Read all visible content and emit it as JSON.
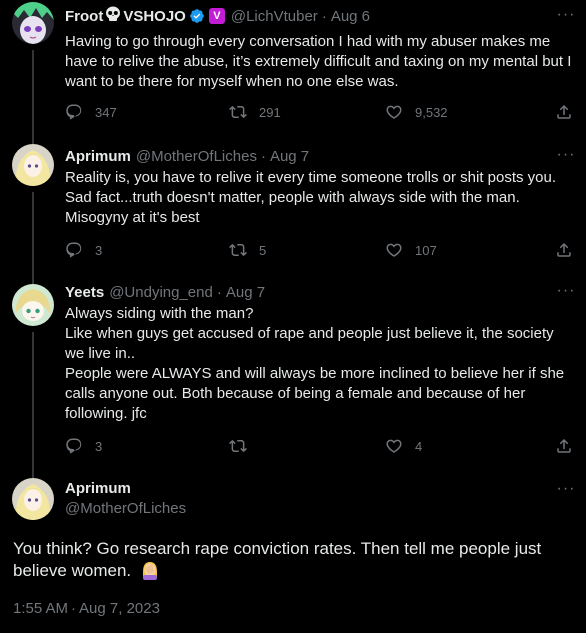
{
  "tweets": [
    {
      "name": "Froot",
      "name_suffix": "VSHOJO",
      "org_badge": "V",
      "handle": "@LichVtuber",
      "date": "Aug 6",
      "text": "Having to go through every conversation I had with my abuser makes me have to relive the abuse, it’s extremely difficult and taxing on my mental but I want to be there for myself when no one else was.",
      "replies": "347",
      "retweets": "291",
      "likes": "9,532"
    },
    {
      "name": "Aprimum",
      "handle": "@MotherOfLiches",
      "date": "Aug 7",
      "text": "Reality is, you have to relive it every time someone trolls or shit posts you. Sad fact...truth doesn't matter, people with always side with the man. Misogyny at it's best",
      "replies": "3",
      "retweets": "5",
      "likes": "107"
    },
    {
      "name": "Yeets",
      "handle": "@Undying_end",
      "date": "Aug 7",
      "text": "Always siding with the man?\nLike when guys get accused of rape and people just believe it, the society we live in..\nPeople were ALWAYS and will always be more inclined to believe her if she calls anyone out. Both because of being a female and because of her following. jfc",
      "replies": "3",
      "retweets": "",
      "likes": "4"
    }
  ],
  "main_tweet": {
    "name": "Aprimum",
    "handle": "@MotherOfLiches",
    "text": "You think? Go research rape conviction rates. Then tell me people just believe women.",
    "time": "1:55 AM",
    "date": "Aug 7, 2023"
  },
  "colors": {
    "background": "#000000",
    "text": "#e7e9ea",
    "secondary": "#71767b",
    "verified": "#1d9bf0",
    "org_badge": "#c21cd6"
  },
  "icons": [
    "reply-icon",
    "retweet-icon",
    "like-icon",
    "share-icon",
    "more-icon",
    "verified-icon",
    "skull-icon",
    "facepalm-emoji"
  ]
}
